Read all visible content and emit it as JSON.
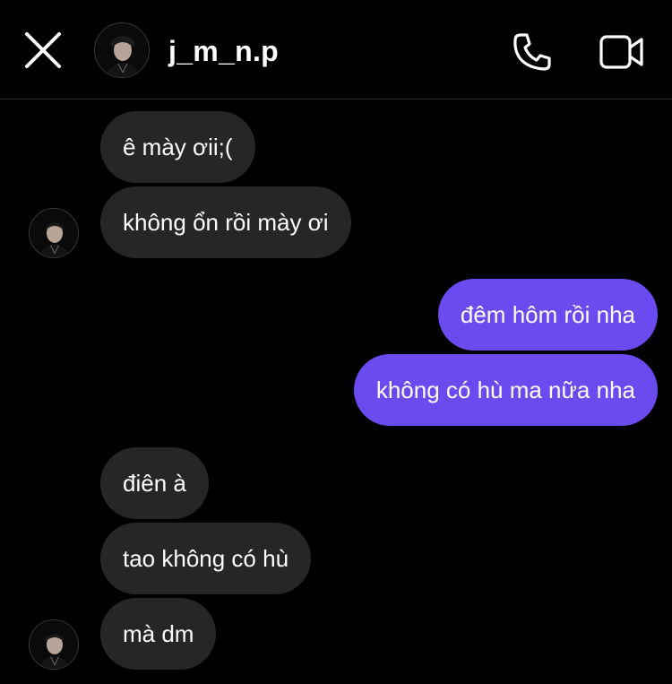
{
  "header": {
    "username": "j_m_n.p",
    "icons": {
      "close": "close-icon",
      "call": "phone-icon",
      "video": "video-camera-icon",
      "avatar": "profile-photo"
    }
  },
  "messages": [
    {
      "direction": "incoming",
      "text": "ê mày ơii;("
    },
    {
      "direction": "incoming",
      "text": "không ổn rồi mày ơi"
    },
    {
      "direction": "outgoing",
      "text": "đêm hôm rồi nha"
    },
    {
      "direction": "outgoing",
      "text": "không có hù ma nữa nha"
    },
    {
      "direction": "incoming",
      "text": "điên à"
    },
    {
      "direction": "incoming",
      "text": "tao không có hù"
    },
    {
      "direction": "incoming",
      "text": "mà dm"
    }
  ],
  "colors": {
    "background": "#000000",
    "incoming_bubble": "#262626",
    "outgoing_bubble": "#6b4bf0",
    "text": "#ffffff"
  }
}
